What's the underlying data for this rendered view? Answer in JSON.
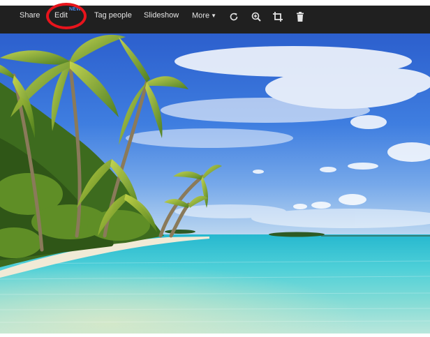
{
  "toolbar": {
    "share_label": "Share",
    "edit_label": "Edit",
    "edit_badge": "NEW",
    "tag_people_label": "Tag people",
    "slideshow_label": "Slideshow",
    "more_label": "More",
    "icons": [
      "rotate-icon",
      "zoom-in-icon",
      "crop-icon",
      "trash-icon"
    ],
    "background_color": "#202020"
  },
  "annotation": {
    "shape": "circle",
    "color": "#e8141c",
    "target": "edit"
  },
  "photo": {
    "subject": "tropical beach with palm trees and turquoise lagoon",
    "sky_color": "#3f77d6",
    "water_color": "#5fd0d6"
  }
}
